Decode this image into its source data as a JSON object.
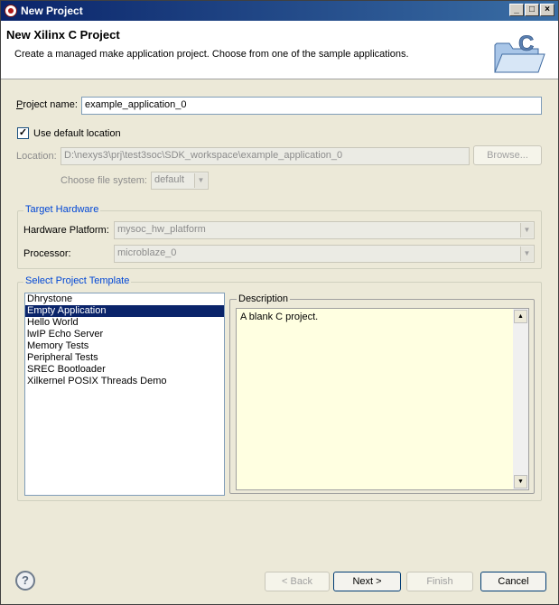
{
  "window": {
    "title": "New Project"
  },
  "header": {
    "title": "New Xilinx C Project",
    "description": "Create a managed make application project. Choose from one of the sample applications."
  },
  "project_name": {
    "label": "Project name:",
    "value": "example_application_0"
  },
  "use_default_location": {
    "label": "Use default location",
    "checked": true
  },
  "location": {
    "label": "Location:",
    "value": "D:\\nexys3\\prj\\test3soc\\SDK_workspace\\example_application_0",
    "browse_label": "Browse..."
  },
  "file_system": {
    "label": "Choose file system:",
    "value": "default"
  },
  "target_hardware": {
    "legend": "Target Hardware",
    "platform_label": "Hardware Platform:",
    "platform_value": "mysoc_hw_platform",
    "processor_label": "Processor:",
    "processor_value": "microblaze_0"
  },
  "template": {
    "legend": "Select Project Template",
    "items": [
      "Dhrystone",
      "Empty Application",
      "Hello World",
      "lwIP Echo Server",
      "Memory Tests",
      "Peripheral Tests",
      "SREC Bootloader",
      "Xilkernel POSIX Threads Demo"
    ],
    "selected": "Empty Application",
    "description_legend": "Description",
    "description_text": "A blank C project."
  },
  "buttons": {
    "back": "< Back",
    "next": "Next >",
    "finish": "Finish",
    "cancel": "Cancel"
  },
  "help": {
    "glyph": "?",
    "icon": "help-icon"
  },
  "colors": {
    "title_bar": "#0a246a",
    "selection": "#0a246a",
    "legend_text": "#0046d5",
    "description_bg": "#ffffe1"
  }
}
